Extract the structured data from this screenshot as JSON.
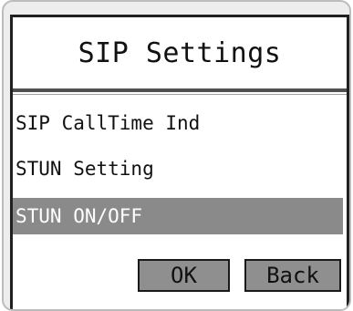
{
  "screen": {
    "title": "SIP Settings"
  },
  "menu": {
    "items": [
      {
        "label": "SIP CallTime Ind",
        "selected": false
      },
      {
        "label": "STUN Setting",
        "selected": false
      },
      {
        "label": "STUN ON/OFF",
        "selected": true
      }
    ]
  },
  "softkeys": {
    "ok_label": "OK",
    "back_label": "Back"
  },
  "colors": {
    "selection_highlight": "#8a8a8a",
    "softkey_fill": "#8f8f8f",
    "device_frame": "#bcbcbc"
  }
}
